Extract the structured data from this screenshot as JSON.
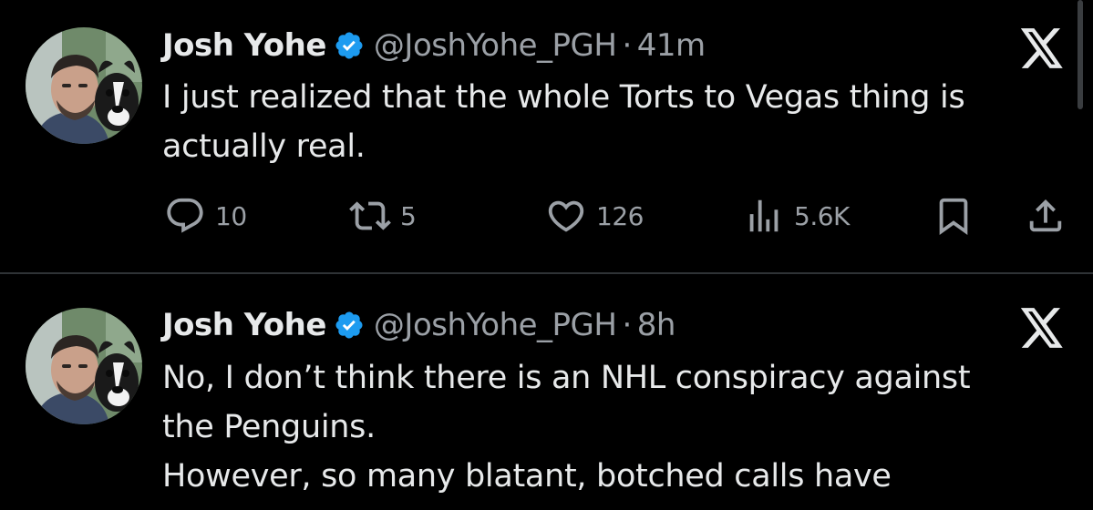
{
  "tweets": [
    {
      "display_name": "Josh Yohe",
      "handle": "@JoshYohe_PGH",
      "separator": "·",
      "timestamp": "41m",
      "text_lines": [
        "I just realized that the whole Torts to Vegas thing is",
        "actually real."
      ],
      "actions": {
        "replies": "10",
        "reposts": "5",
        "likes": "126",
        "views": "5.6K"
      }
    },
    {
      "display_name": "Josh Yohe",
      "handle": "@JoshYohe_PGH",
      "separator": "·",
      "timestamp": "8h",
      "text_lines": [
        "No, I don’t think there is an NHL conspiracy against",
        "the Penguins.",
        "However, so many blatant, botched calls have"
      ]
    }
  ],
  "icons": {
    "verified": "verified-badge-icon",
    "platform": "x-logo-icon",
    "reply": "reply-icon",
    "repost": "repost-icon",
    "like": "heart-icon",
    "views": "views-icon",
    "bookmark": "bookmark-icon",
    "share": "share-icon"
  },
  "colors": {
    "background": "#000000",
    "primary_text": "#e7e9ea",
    "secondary_text": "#9ba0a6",
    "verified_blue": "#1d9bf0",
    "divider": "#2f3336"
  }
}
